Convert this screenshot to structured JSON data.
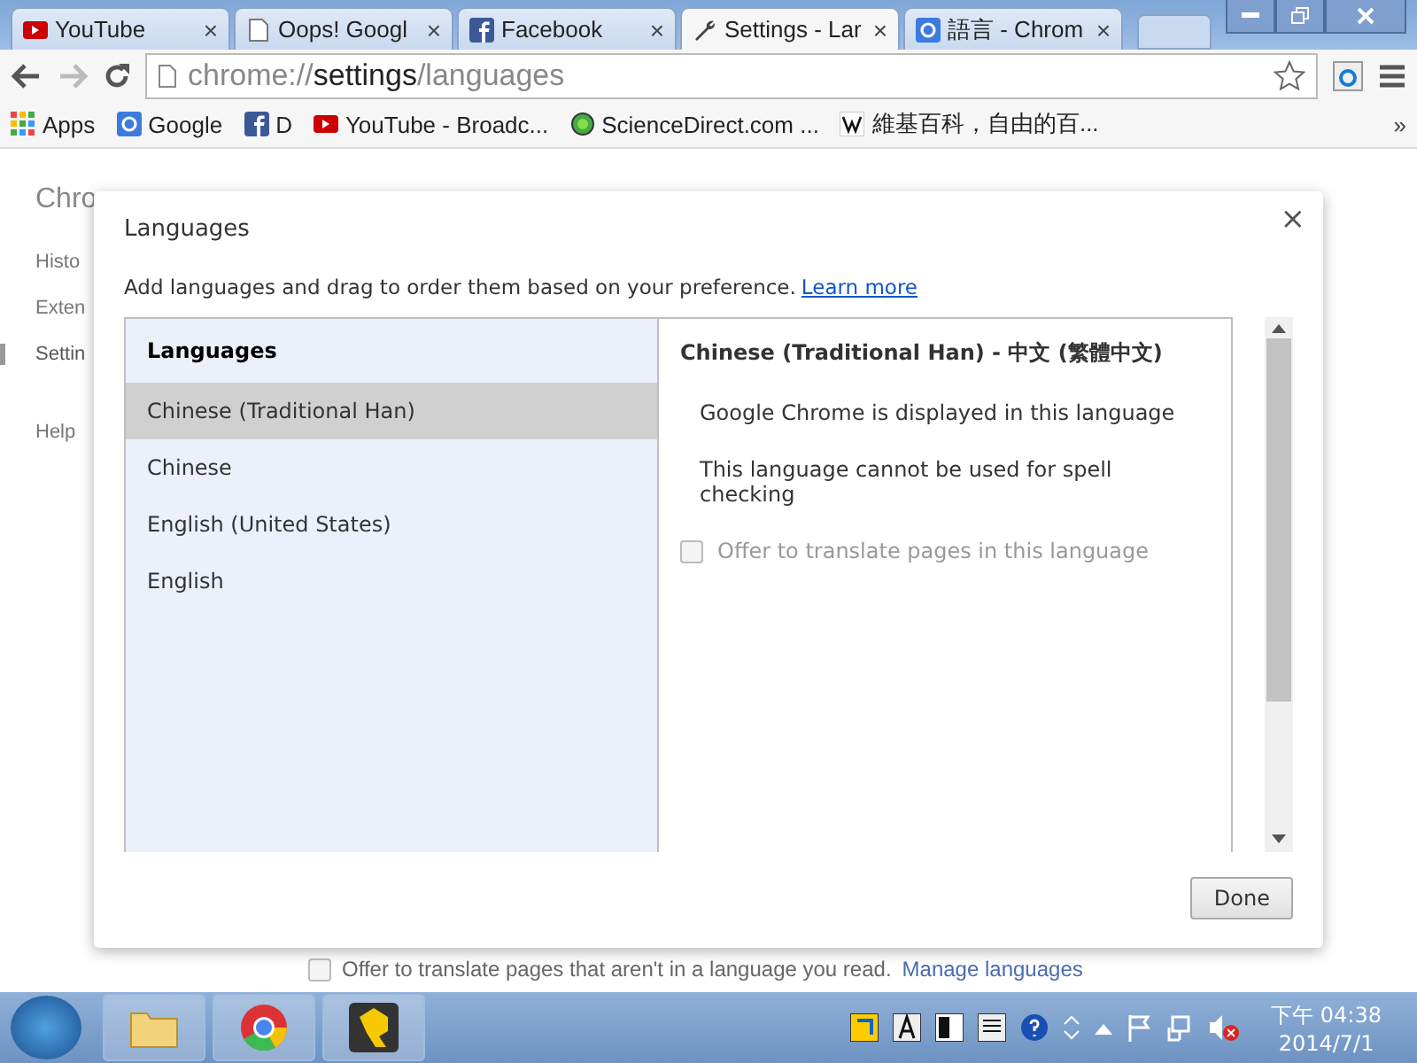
{
  "tabs": [
    {
      "title": "YouTube",
      "close": "×",
      "selected": false
    },
    {
      "title": "Oops! Googl",
      "close": "×",
      "selected": false
    },
    {
      "title": "Facebook",
      "close": "×",
      "selected": false
    },
    {
      "title": "Settings - Lar",
      "close": "×",
      "selected": true
    },
    {
      "title": "語言 - Chrom",
      "close": "×",
      "selected": false
    }
  ],
  "address": {
    "scheme": "chrome://",
    "host": "settings",
    "path": "/languages"
  },
  "bookmarks": [
    {
      "label": "Apps"
    },
    {
      "label": "Google"
    },
    {
      "label": "D"
    },
    {
      "label": "YouTube - Broadc..."
    },
    {
      "label": "ScienceDirect.com ..."
    },
    {
      "label": "維基百科，自由的百..."
    }
  ],
  "bookmarks_more": "»",
  "page": {
    "title": "Chro",
    "nav": [
      {
        "label": "Histo",
        "selected": false
      },
      {
        "label": "Exten",
        "selected": false
      },
      {
        "label": "Settin",
        "selected": true
      },
      {
        "label": "Help",
        "selected": false
      }
    ],
    "footer": {
      "text": "Offer to translate pages that aren't in a language you read.",
      "link": "Manage languages",
      "checked": false
    }
  },
  "dialog": {
    "title": "Languages",
    "close": "×",
    "intro": "Add languages and drag to order them based on your preference.",
    "intro_link": "Learn more",
    "list_header": "Languages",
    "languages": [
      {
        "name": "Chinese (Traditional Han)",
        "selected": true
      },
      {
        "name": "Chinese",
        "selected": false
      },
      {
        "name": "English (United States)",
        "selected": false
      },
      {
        "name": "English",
        "selected": false
      }
    ],
    "detail": {
      "heading": "Chinese (Traditional Han) - 中文 (繁體中文)",
      "notes": [
        "Google Chrome is displayed in this language",
        "This language cannot be used for spell checking"
      ],
      "translate": {
        "label": "Offer to translate pages in this language",
        "checked": false,
        "disabled": true
      }
    },
    "done": "Done"
  },
  "taskbar": {
    "time": "下午 04:38",
    "date": "2014/7/1"
  }
}
